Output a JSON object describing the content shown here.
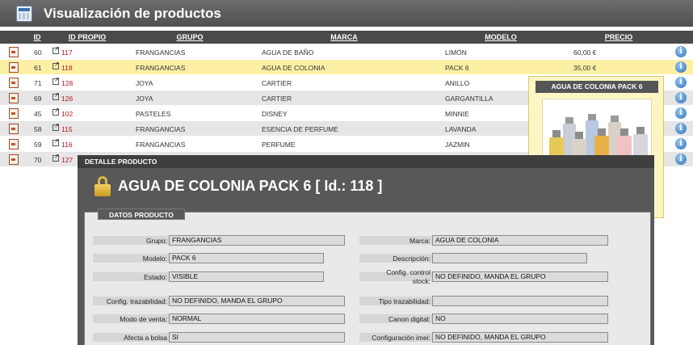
{
  "app": {
    "title": "Visualización de productos",
    "icon": "spreadsheet-icon"
  },
  "table": {
    "headers": {
      "id": "ID",
      "id_propio": "ID PROPIO",
      "grupo": "GRUPO",
      "marca": "MARCA",
      "modelo": "MODELO",
      "precio": "PRECIO"
    },
    "rows": [
      {
        "id": "60",
        "id_propio": "117",
        "grupo": "FRANGANCIAS",
        "marca": "AGUA DE BAÑO",
        "modelo": "LIMÓN",
        "precio": "60,00 €"
      },
      {
        "id": "61",
        "id_propio": "118",
        "grupo": "FRANGANCIAS",
        "marca": "AGUA DE COLONIA",
        "modelo": "PACK 6",
        "precio": "35,00 €"
      },
      {
        "id": "71",
        "id_propio": "128",
        "grupo": "JOYA",
        "marca": "CARTIER",
        "modelo": "ANILLO",
        "precio": ""
      },
      {
        "id": "69",
        "id_propio": "126",
        "grupo": "JOYA",
        "marca": "CARTIER",
        "modelo": "GARGANTILLA",
        "precio": ""
      },
      {
        "id": "45",
        "id_propio": "102",
        "grupo": "PASTELES",
        "marca": "DISNEY",
        "modelo": "MINNIE",
        "precio": ""
      },
      {
        "id": "58",
        "id_propio": "115",
        "grupo": "FRANGANCIAS",
        "marca": "ESENCIA DE PERFUME",
        "modelo": "LAVANDA",
        "precio": ""
      },
      {
        "id": "59",
        "id_propio": "116",
        "grupo": "FRANGANCIAS",
        "marca": "PERFUME",
        "modelo": "JAZMIN",
        "precio": ""
      },
      {
        "id": "70",
        "id_propio": "127",
        "grupo": "",
        "marca": "",
        "modelo": "",
        "precio": ""
      }
    ]
  },
  "popup": {
    "title": "AGUA DE COLONIA PACK 6"
  },
  "detail": {
    "header": "DETALLE PRODUCTO",
    "title": "AGUA DE COLONIA PACK 6 [ Id.: 118 ]",
    "section": "DATOS PRODUCTO",
    "fields": {
      "grupo": {
        "label": "Grupo:",
        "value": "FRANGANCIAS"
      },
      "marca": {
        "label": "Marca:",
        "value": "AGUA DE COLONIA"
      },
      "modelo": {
        "label": "Modelo:",
        "value": "PACK 6"
      },
      "descripcion": {
        "label": "Descripción:",
        "value": ""
      },
      "estado": {
        "label": "Estado:",
        "value": "VISIBLE"
      },
      "config_control_stock": {
        "label_line1": "Config. control",
        "label_line2": "stock:",
        "value": "NO DEFINIDO, MANDA EL GRUPO"
      },
      "config_trazabilidad": {
        "label": "Config. trazabilidad:",
        "value": "NO DEFINIDO, MANDA EL GRUPO"
      },
      "tipo_trazabilidad": {
        "label": "Tipo trazabilidad:",
        "value": ""
      },
      "modo_venta": {
        "label": "Modo de venta:",
        "value": "NORMAL"
      },
      "canon_digital": {
        "label": "Canon digital:",
        "value": "NO"
      },
      "afecta_bolsa": {
        "label": "Afecta a bolsa",
        "value": "SI"
      },
      "configuracion_imei": {
        "label": "Configuración imei:",
        "value": "NO DEFINIDO, MANDA EL GRUPO"
      }
    }
  },
  "colors": {
    "highlight_row": "#fdf0a5",
    "product_id": "#c0111d",
    "header_bg": "#4a4a4a"
  }
}
